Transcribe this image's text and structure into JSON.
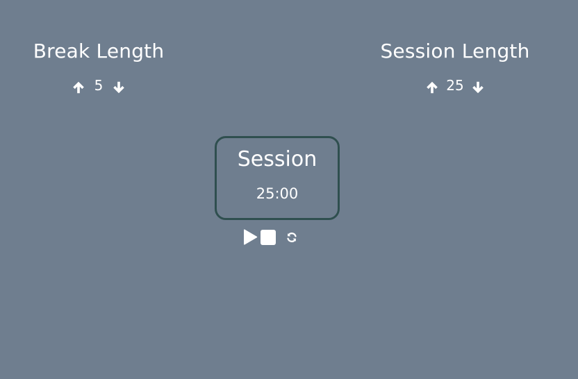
{
  "break": {
    "label": "Break Length",
    "value": "5",
    "increment_icon": "arrow-up-icon",
    "decrement_icon": "arrow-down-icon"
  },
  "session": {
    "label": "Session Length",
    "value": "25",
    "increment_icon": "arrow-up-icon",
    "decrement_icon": "arrow-down-icon"
  },
  "timer": {
    "label": "Session",
    "time_left": "25:00"
  },
  "controls": {
    "play_icon": "play-icon",
    "stop_icon": "stop-icon",
    "reset_icon": "refresh-icon"
  },
  "colors": {
    "background": "#6f7e8f",
    "text": "#ffffff",
    "timer_border": "#2f4f4f"
  }
}
